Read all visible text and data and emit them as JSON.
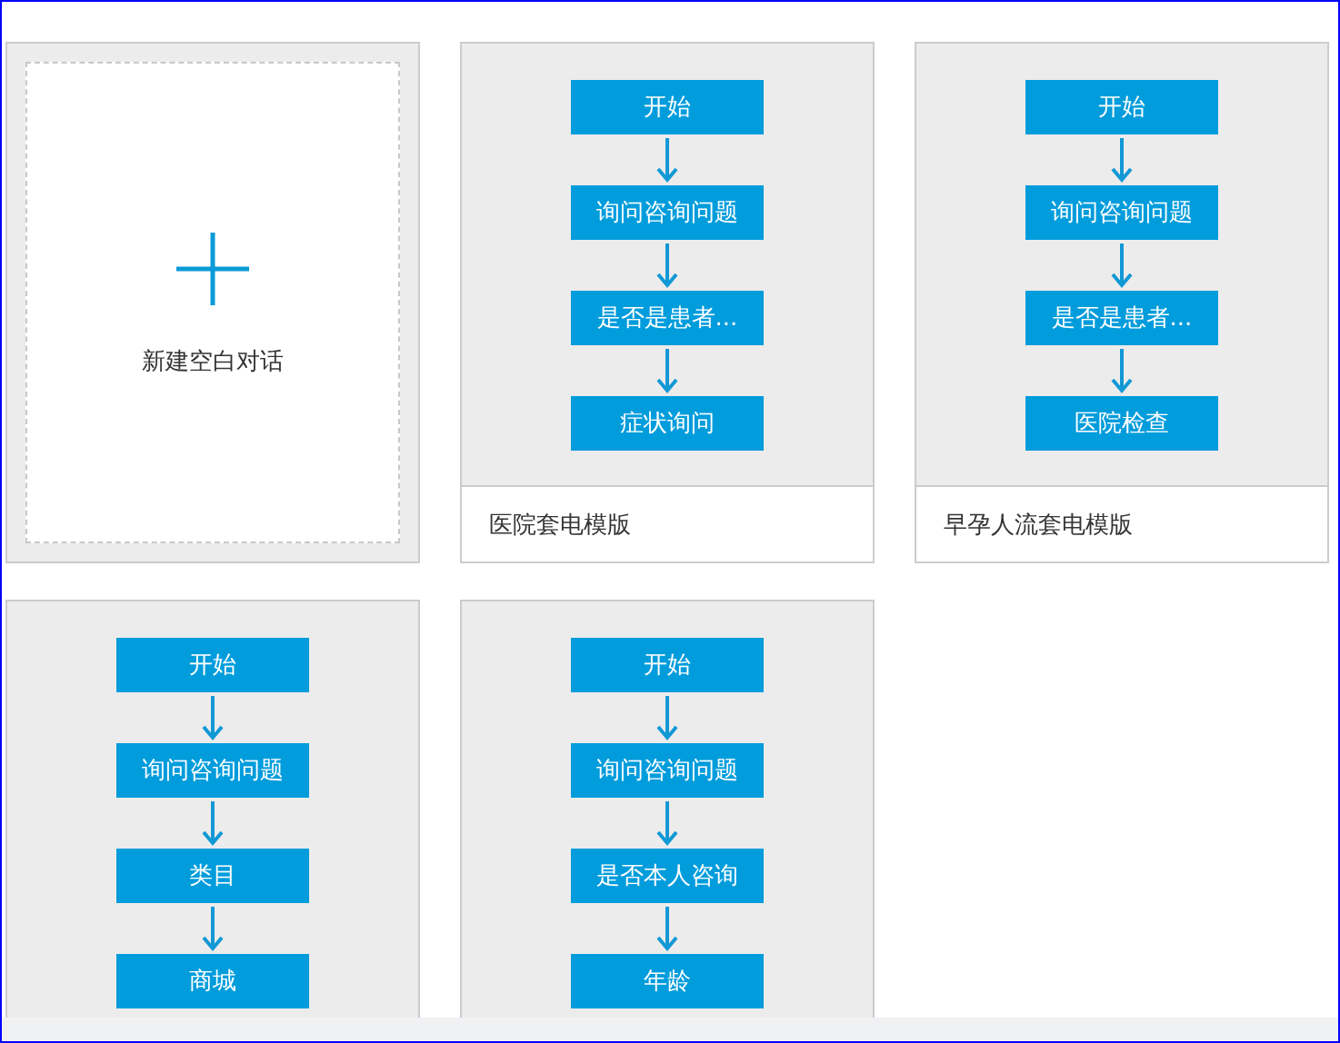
{
  "new_card": {
    "label": "新建空白对话"
  },
  "templates": [
    {
      "nodes": [
        "开始",
        "询问咨询问题",
        "是否是患者...",
        "症状询问"
      ],
      "name": "医院套电模版"
    },
    {
      "nodes": [
        "开始",
        "询问咨询问题",
        "是否是患者...",
        "医院检查"
      ],
      "name": "早孕人流套电模版"
    },
    {
      "nodes": [
        "开始",
        "询问咨询问题",
        "类目",
        "商城"
      ]
    },
    {
      "nodes": [
        "开始",
        "询问咨询问题",
        "是否本人咨询",
        "年龄"
      ]
    }
  ]
}
